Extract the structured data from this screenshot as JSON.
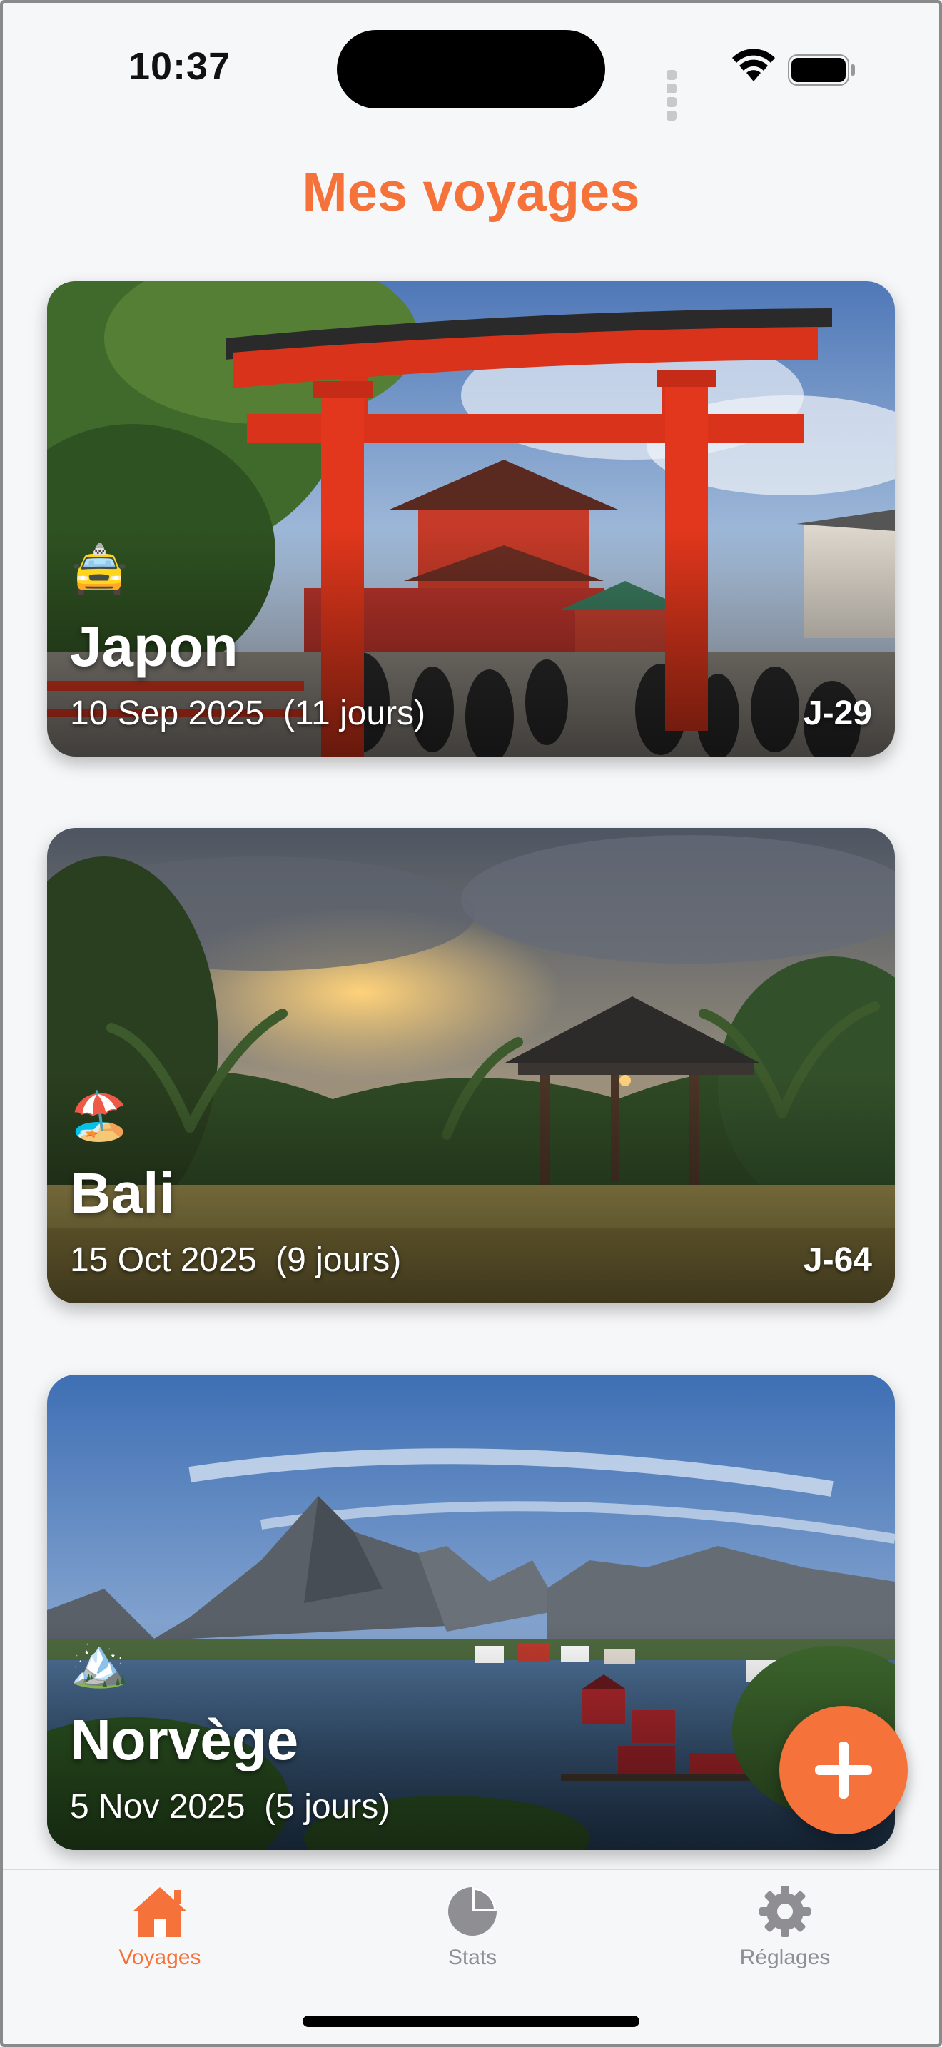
{
  "status_bar": {
    "time": "10:37"
  },
  "header": {
    "title": "Mes voyages"
  },
  "trips": [
    {
      "emoji": "🚖",
      "destination": "Japon",
      "dates": "10 Sep 2025  (11 jours)",
      "countdown": "J-29"
    },
    {
      "emoji": "🏖️",
      "destination": "Bali",
      "dates": "15 Oct 2025  (9 jours)",
      "countdown": "J-64"
    },
    {
      "emoji": "🏔️",
      "destination": "Norvège",
      "dates": "5 Nov 2025  (5 jours)",
      "countdown": ""
    }
  ],
  "fab": {
    "icon": "plus-icon"
  },
  "tabbar": {
    "tabs": [
      {
        "label": "Voyages",
        "icon": "home-icon",
        "active": true
      },
      {
        "label": "Stats",
        "icon": "pie-chart-icon",
        "active": false
      },
      {
        "label": "Réglages",
        "icon": "gear-icon",
        "active": false
      }
    ]
  },
  "colors": {
    "accent": "#f5733b",
    "inactive": "#8e8e93"
  }
}
